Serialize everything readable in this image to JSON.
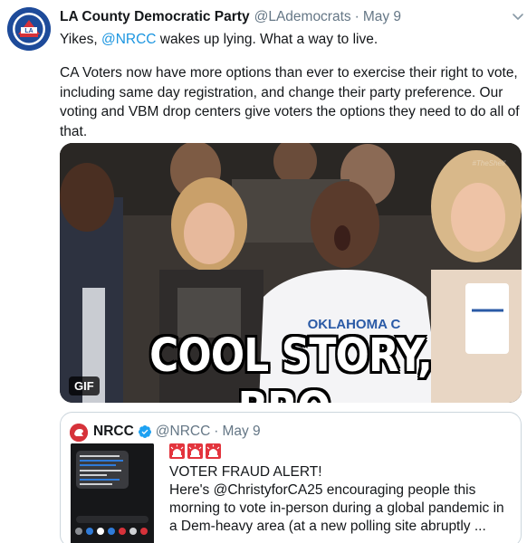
{
  "tweet": {
    "author_name": "LA County Democratic Party",
    "author_handle": "@LAdemocrats",
    "separator": "·",
    "date": "May 9",
    "text_prefix": "Yikes,",
    "mention": "@NRCC",
    "text_suffix": "wakes up lying. What a way to live.",
    "paragraph": "CA Voters now have more options than ever to exercise their right to vote, including same day registration, and change their party preference. Our voting and VBM drop centers give voters the options they need to do all of that.",
    "avatar_icon": "la-county-democratic-party-logo",
    "menu_icon": "chevron-down-icon"
  },
  "media": {
    "caption": "COOL STORY, BRO.",
    "badge": "GIF",
    "shirt_text": "OKLAHOMA C",
    "watermark": "#TheShelf"
  },
  "quote": {
    "author_name": "NRCC",
    "author_handle": "@NRCC",
    "separator": "·",
    "date": "May 9",
    "verified_icon": "verified-badge-icon",
    "siren_icon": "police-light-emoji",
    "lines": [
      "VOTER FRAUD ALERT!",
      "Here's @ChristyforCA25 encouraging people this",
      "morning to vote in-person during a global pandemic in",
      "a Dem-heavy area (at a new polling site abruptly ..."
    ]
  },
  "colors": {
    "text": "#14171a",
    "secondary": "#657786",
    "link": "#1b95e0",
    "border": "#ccd6dd",
    "verified": "#1da1f2",
    "nrcc_red": "#d6323a",
    "la_blue": "#1e4b9a"
  }
}
